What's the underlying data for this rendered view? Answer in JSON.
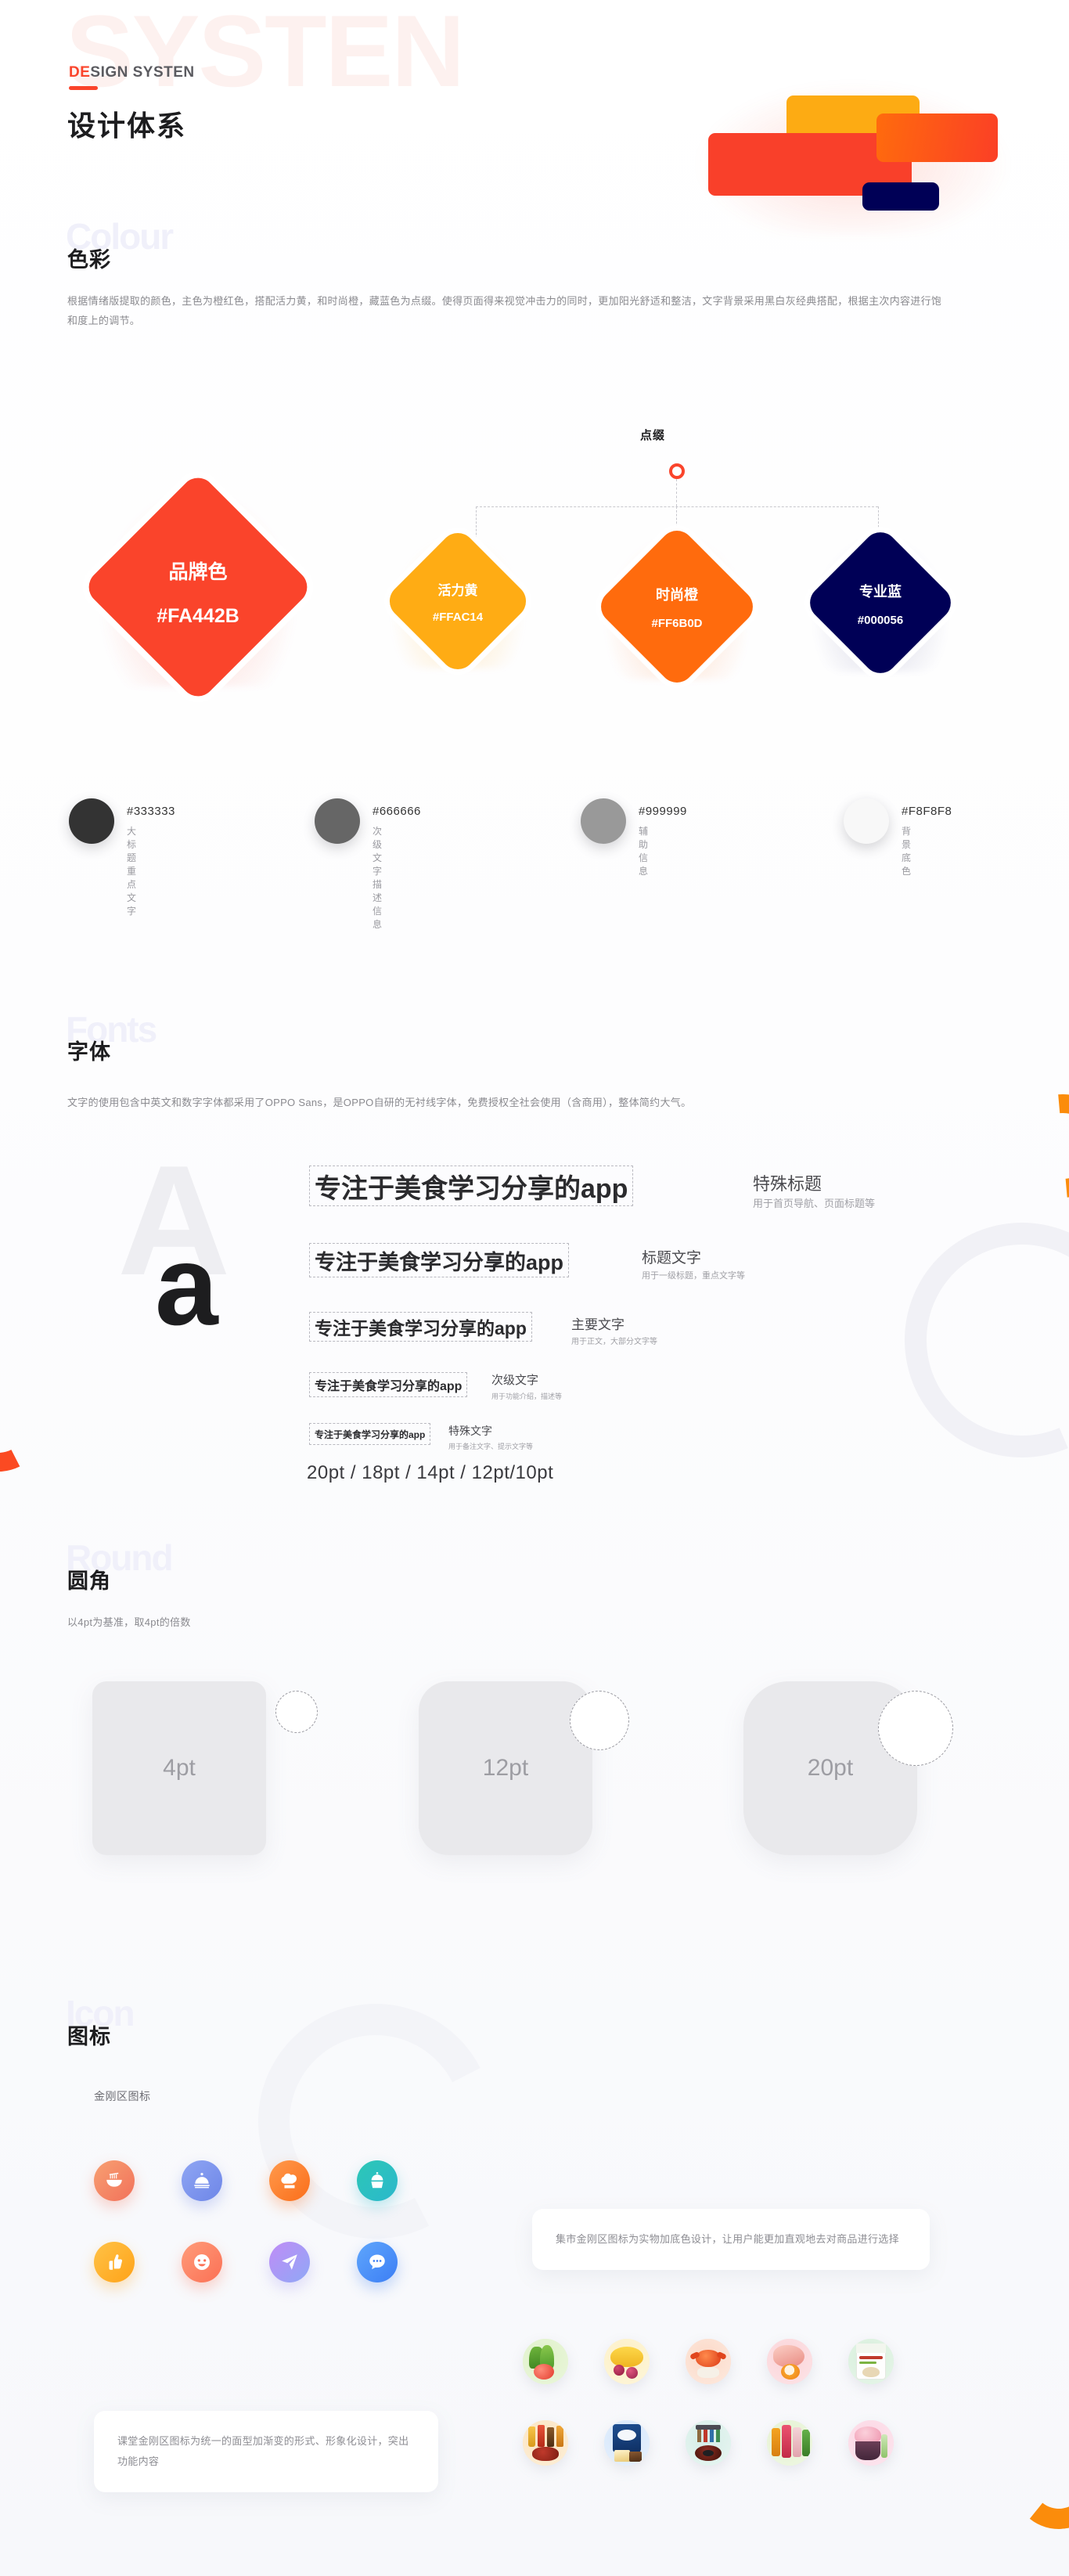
{
  "header": {
    "ghost_text": "SYSTEN",
    "kicker_highlight": "DE",
    "kicker_rest": "SIGN SYSTEN",
    "title": "设计体系",
    "deco_colors": {
      "yellow": "#FDAB13",
      "red": "#F9402A",
      "orange": "#FF6B0D",
      "navy": "#000056"
    }
  },
  "colour": {
    "ghost_text": "Colour",
    "title": "色彩",
    "description": "根据情绪版提取的颜色，主色为橙红色，搭配活力黄，和时尚橙，藏蓝色为点缀。使得页面得来视觉冲击力的同时，更加阳光舒适和整洁，文字背景采用黑白灰经典搭配，根据主次内容进行饱和度上的调节。",
    "accent_label": "点缀",
    "swatches": [
      {
        "name": "品牌色",
        "hex": "#FA442B"
      },
      {
        "name": "活力黄",
        "hex": "#FFAC14"
      },
      {
        "name": "时尚橙",
        "hex": "#FF6B0D"
      },
      {
        "name": "专业蓝",
        "hex": "#000056"
      }
    ],
    "greys": [
      {
        "hex": "#333333",
        "usage": "大标题 重点文字"
      },
      {
        "hex": "#666666",
        "usage": "次级文字 描述信息"
      },
      {
        "hex": "#999999",
        "usage": "辅助信息"
      },
      {
        "hex": "#F8F8F8",
        "usage": "背景底色"
      }
    ]
  },
  "fonts": {
    "ghost_text": "Fonts",
    "title": "字体",
    "description": "文字的使用包含中英文和数字字体都采用了OPPO Sans，是OPPO自研的无衬线字体，免费授权全社会使用（含商用），整体简约大气。",
    "glyph_large": "A",
    "glyph_small": "a",
    "samples": [
      {
        "sample": "专注于美食学习分享的app",
        "title": "特殊标题",
        "usage": "用于首页导航、页面标题等"
      },
      {
        "sample": "专注于美食学习分享的app",
        "title": "标题文字",
        "usage": "用于一级标题，重点文字等"
      },
      {
        "sample": "专注于美食学习分享的app",
        "title": "主要文字",
        "usage": "用于正文，大部分文字等"
      },
      {
        "sample": "专注于美食学习分享的app",
        "title": "次级文字",
        "usage": "用于功能介绍，描述等"
      },
      {
        "sample": "专注于美食学习分享的app",
        "title": "特殊文字",
        "usage": "用于备注文字、提示文字等"
      }
    ],
    "scale": "20pt / 18pt / 14pt / 12pt/10pt"
  },
  "round": {
    "ghost_text": "Round",
    "title": "圆角",
    "description": "以4pt为基准，取4pt的倍数",
    "boxes": [
      {
        "label": "4pt"
      },
      {
        "label": "12pt"
      },
      {
        "label": "20pt"
      }
    ]
  },
  "icon": {
    "ghost_text": "Icon",
    "title": "图标",
    "subtitle": "金刚区图标",
    "note_right": "集市金刚区图标为实物加底色设计，让用户能更加直观地去对商品进行选择",
    "note_left": "课堂金刚区图标为统一的面型加渐变的形式、形象化设计，突出功能内容",
    "kingkong": [
      {
        "icon": "noodle-bowl-icon",
        "from": "#F7A072",
        "to": "#F2715A"
      },
      {
        "icon": "cloche-icon",
        "from": "#7D9BF0",
        "to": "#6E86E8"
      },
      {
        "icon": "chef-hat-icon",
        "from": "#FF9A4D",
        "to": "#FB6E1A"
      },
      {
        "icon": "cupcake-icon",
        "from": "#2CC7B6",
        "to": "#2BBCC9"
      },
      {
        "icon": "hand-thumb-icon",
        "from": "#FFC247",
        "to": "#FFA318"
      },
      {
        "icon": "smiley-face-icon",
        "from": "#FF9C7A",
        "to": "#FB7055"
      },
      {
        "icon": "paper-plane-icon",
        "from": "#B98BF5",
        "to": "#8FA8F6"
      },
      {
        "icon": "chat-bubble-icon",
        "from": "#4F9BFB",
        "to": "#3C7EF5"
      }
    ],
    "products": [
      {
        "name": "蔬菜",
        "bg": "#E8F6D8"
      },
      {
        "name": "水果",
        "bg": "#FDEFC8"
      },
      {
        "name": "海鲜",
        "bg": "#FDE0D2"
      },
      {
        "name": "肉类",
        "bg": "#FBD8DB"
      },
      {
        "name": "米面粮油",
        "bg": "#D8F0DC"
      },
      {
        "name": "调味品",
        "bg": "#FBE6C6"
      },
      {
        "name": "乳品烘焙",
        "bg": "#D8E8FA"
      },
      {
        "name": "厨房用品",
        "bg": "#D9EFEA"
      },
      {
        "name": "酒水饮料",
        "bg": "#E7F3D6"
      },
      {
        "name": "冰品甜点",
        "bg": "#FBD9E6"
      }
    ]
  }
}
